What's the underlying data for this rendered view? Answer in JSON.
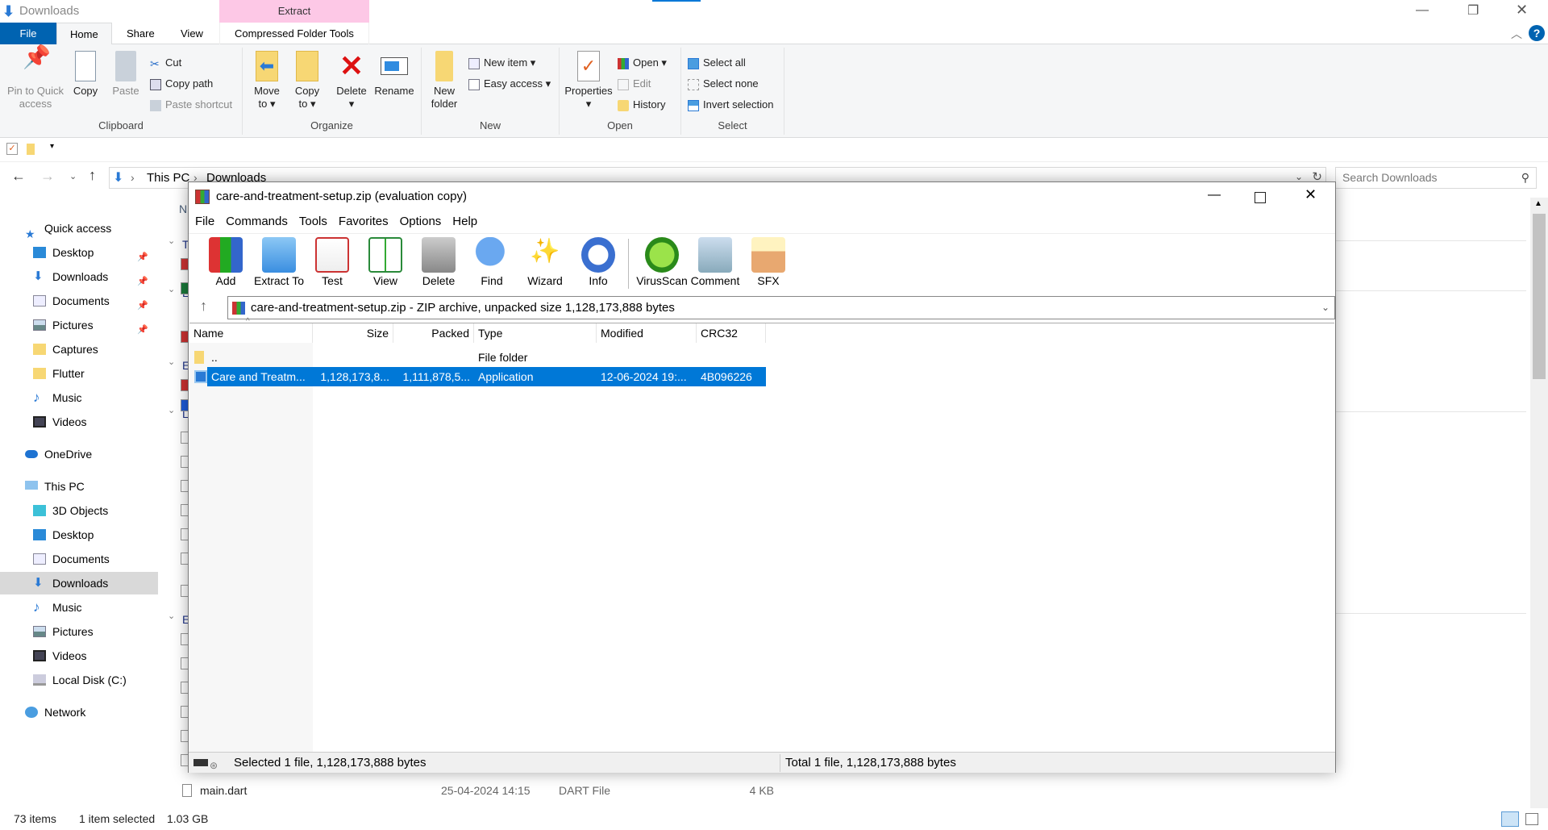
{
  "explorer": {
    "window_title": "Downloads",
    "contextual_tab_group": "Extract",
    "tabs": [
      {
        "label": "File"
      },
      {
        "label": "Home"
      },
      {
        "label": "Share"
      },
      {
        "label": "View"
      },
      {
        "label": "Compressed Folder Tools"
      }
    ],
    "ribbon": {
      "clipboard": {
        "label": "Clipboard",
        "pin": "Pin to Quick access",
        "copy": "Copy",
        "paste": "Paste",
        "cut": "Cut",
        "copy_path": "Copy path",
        "paste_shortcut": "Paste shortcut"
      },
      "organize": {
        "label": "Organize",
        "move_to": "Move to",
        "copy_to": "Copy to",
        "delete": "Delete",
        "rename": "Rename"
      },
      "new": {
        "label": "New",
        "new_folder": "New folder",
        "new_item": "New item",
        "easy_access": "Easy access"
      },
      "open": {
        "label": "Open",
        "properties": "Properties",
        "open": "Open",
        "edit": "Edit",
        "history": "History"
      },
      "select": {
        "label": "Select",
        "select_all": "Select all",
        "select_none": "Select none",
        "invert": "Invert selection"
      }
    },
    "breadcrumb": [
      "This PC",
      "Downloads"
    ],
    "search_placeholder": "Search Downloads",
    "nav": {
      "quick_access": "Quick access",
      "quick_items": [
        {
          "label": "Desktop",
          "pinned": true
        },
        {
          "label": "Downloads",
          "pinned": true
        },
        {
          "label": "Documents",
          "pinned": true
        },
        {
          "label": "Pictures",
          "pinned": true
        },
        {
          "label": "Captures"
        },
        {
          "label": "Flutter"
        },
        {
          "label": "Music"
        },
        {
          "label": "Videos"
        }
      ],
      "onedrive": "OneDrive",
      "this_pc": "This PC",
      "pc_items": [
        {
          "label": "3D Objects"
        },
        {
          "label": "Desktop"
        },
        {
          "label": "Documents"
        },
        {
          "label": "Downloads",
          "selected": true
        },
        {
          "label": "Music"
        },
        {
          "label": "Pictures"
        },
        {
          "label": "Videos"
        },
        {
          "label": "Local Disk (C:)"
        }
      ],
      "network": "Network"
    },
    "list_partial": {
      "column": "N",
      "groups": [
        "T",
        "L",
        "E",
        "L",
        "E"
      ]
    },
    "visible_row": {
      "name": "main.dart",
      "modified": "25-04-2024 14:15",
      "type": "DART File",
      "size": "4 KB"
    },
    "status": {
      "count": "73 items",
      "selected": "1 item selected",
      "size": "1.03 GB"
    }
  },
  "winrar": {
    "title": "care-and-treatment-setup.zip (evaluation copy)",
    "menu": [
      "File",
      "Commands",
      "Tools",
      "Favorites",
      "Options",
      "Help"
    ],
    "toolbar": [
      {
        "label": "Add",
        "icon": "add-archive-icon"
      },
      {
        "label": "Extract To",
        "icon": "extract-folder-icon"
      },
      {
        "label": "Test",
        "icon": "test-clipboard-icon"
      },
      {
        "label": "View",
        "icon": "view-book-icon"
      },
      {
        "label": "Delete",
        "icon": "trash-icon"
      },
      {
        "label": "Find",
        "icon": "magnifier-icon"
      },
      {
        "label": "Wizard",
        "icon": "wand-icon"
      },
      {
        "label": "Info",
        "icon": "info-icon"
      },
      {
        "label": "VirusScan",
        "icon": "bug-icon"
      },
      {
        "label": "Comment",
        "icon": "comment-icon"
      },
      {
        "label": "SFX",
        "icon": "sfx-box-icon"
      }
    ],
    "path": "care-and-treatment-setup.zip - ZIP archive, unpacked size 1,128,173,888 bytes",
    "columns": [
      "Name",
      "Size",
      "Packed",
      "Type",
      "Modified",
      "CRC32"
    ],
    "rows": [
      {
        "name": "..",
        "size": "",
        "packed": "",
        "type": "File folder",
        "modified": "",
        "crc": ""
      },
      {
        "name": "Care and Treatm...",
        "size": "1,128,173,8...",
        "packed": "1,111,878,5...",
        "type": "Application",
        "modified": "12-06-2024 19:...",
        "crc": "4B096226",
        "selected": true
      }
    ],
    "status_left": "Selected 1 file, 1,128,173,888 bytes",
    "status_right": "Total 1 file, 1,128,173,888 bytes"
  },
  "colors": {
    "accent": "#0063b1",
    "selection": "#0078d7",
    "contextual": "#fdc8e6",
    "nav_selected": "#d9d9d9"
  }
}
